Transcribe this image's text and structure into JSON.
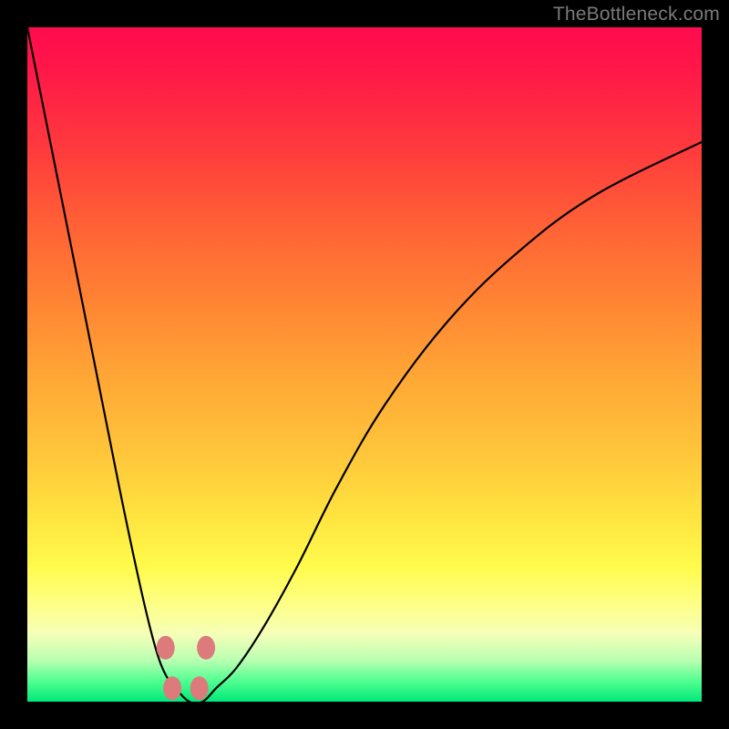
{
  "watermark": "TheBottleneck.com",
  "colors": {
    "frame": "#000000",
    "curve": "#000000",
    "marker": "#dd7a7b"
  },
  "chart_data": {
    "type": "line",
    "title": "",
    "xlabel": "",
    "ylabel": "",
    "xlim": [
      0,
      100
    ],
    "ylim": [
      0,
      100
    ],
    "grid": false,
    "series": [
      {
        "name": "bottleneck-curve",
        "x": [
          0,
          5,
          10,
          14,
          17,
          19,
          20.5,
          22,
          24,
          26,
          28,
          31,
          35,
          40,
          46,
          53,
          62,
          72,
          84,
          100
        ],
        "y": [
          100,
          75,
          50,
          30,
          16,
          8,
          4,
          2,
          0,
          0,
          2,
          5,
          11,
          20,
          32,
          44,
          56,
          66,
          75,
          83
        ]
      }
    ],
    "markers": [
      {
        "x": 20.5,
        "y": 8
      },
      {
        "x": 26.5,
        "y": 8
      },
      {
        "x": 21.5,
        "y": 2
      },
      {
        "x": 25.5,
        "y": 2
      }
    ],
    "background_gradient": [
      {
        "stop": 0.0,
        "color": "#ff0b4e"
      },
      {
        "stop": 0.5,
        "color": "#ff9a35"
      },
      {
        "stop": 0.8,
        "color": "#fffb4c"
      },
      {
        "stop": 1.0,
        "color": "#00e87a"
      }
    ]
  }
}
